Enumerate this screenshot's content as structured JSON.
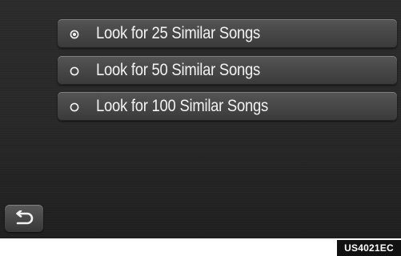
{
  "options": [
    {
      "label": "Look for 25 Similar Songs",
      "selected": true
    },
    {
      "label": "Look for 50 Similar Songs",
      "selected": false
    },
    {
      "label": "Look for 100 Similar Songs",
      "selected": false
    }
  ],
  "back_button": {
    "icon": "back-arrow-icon"
  },
  "image_code": "US4021EC",
  "colors": {
    "screen_background": "#282828",
    "button_background": "#484848",
    "text": "#f2f2f2"
  }
}
